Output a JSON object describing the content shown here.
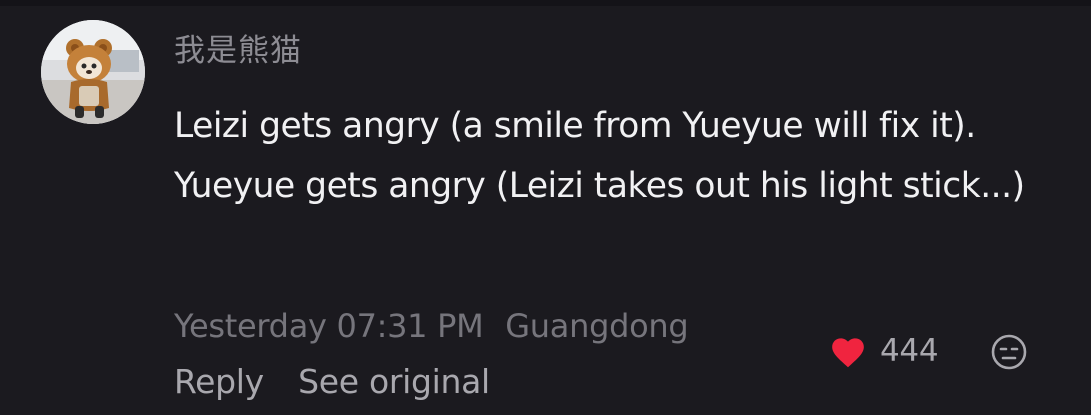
{
  "comment": {
    "username": "我是熊猫",
    "text": "Leizi gets angry (a smile from Yueyue will fix it). Yueyue gets angry (Leizi takes out his light stick...)",
    "timestamp": "Yesterday 07:31 PM",
    "location": "Guangdong",
    "reply_label": "Reply",
    "see_original_label": "See original",
    "like_count": "444",
    "avatar_icon": "bear-avatar",
    "like_icon": "heart-icon",
    "emoji_icon": "emoji-face-icon"
  },
  "colors": {
    "background": "#1b1a1f",
    "like_heart": "#f0243f",
    "text_primary": "#f1f1f3",
    "text_secondary": "#76757c"
  }
}
